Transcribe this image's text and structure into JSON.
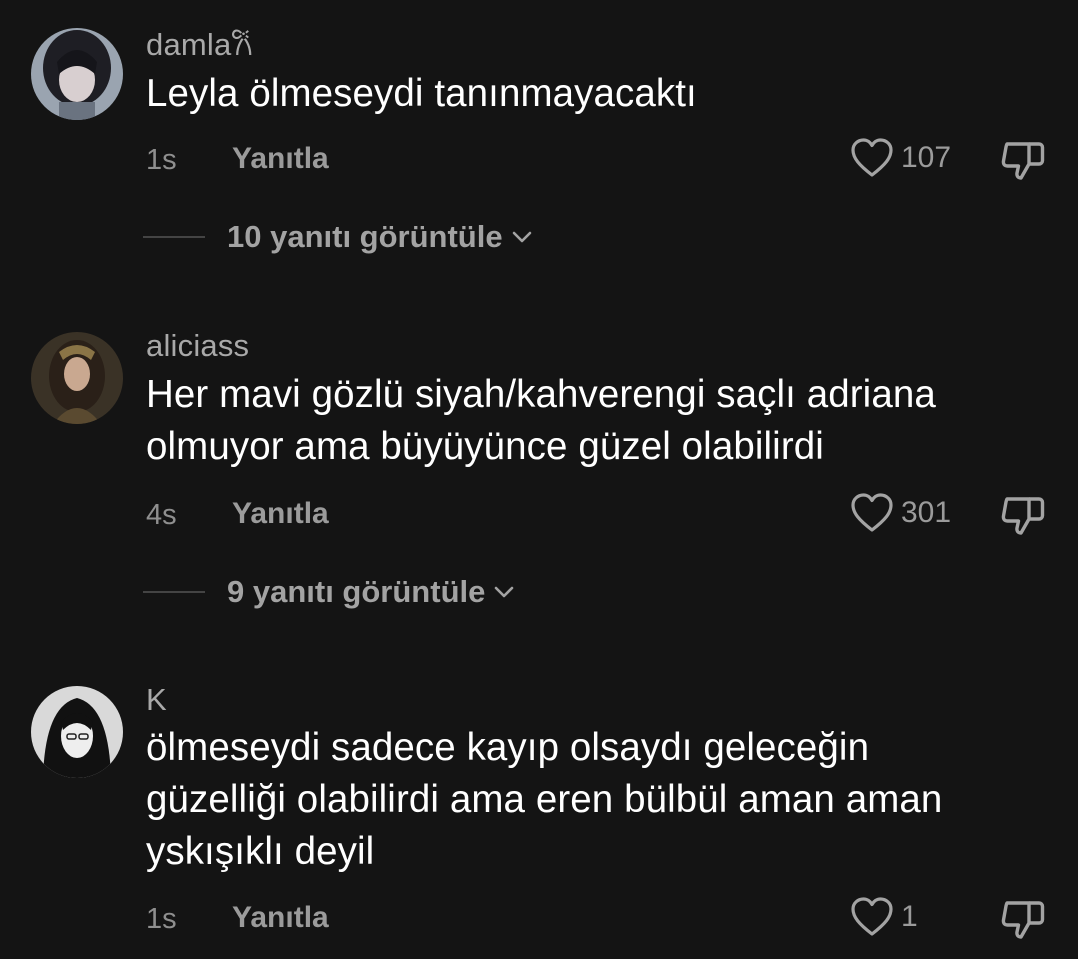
{
  "comments": [
    {
      "username": "damla𐙚",
      "text": "Leyla ölmeseydi tanınmayacaktı",
      "time": "1s",
      "reply_label": "Yanıtla",
      "likes": "107",
      "view_replies": "10 yanıtı görüntüle"
    },
    {
      "username": "aliciass",
      "text": "Her mavi gözlü siyah/kahverengi saçlı adriana olmuyor ama büyüyünce güzel olabilirdi",
      "time": "4s",
      "reply_label": "Yanıtla",
      "likes": "301",
      "view_replies": "9 yanıtı görüntüle"
    },
    {
      "username": "K",
      "text": "ölmeseydi sadece kayıp olsaydı geleceğin güzelliği olabilirdi ama eren bülbül aman aman yskışıklı deyil",
      "time": "1s",
      "reply_label": "Yanıtla",
      "likes": "1"
    }
  ],
  "icons": {
    "like": "heart-outline-icon",
    "dislike": "thumbs-down-outline-icon",
    "expand": "chevron-down-icon"
  },
  "colors": {
    "background": "#141414",
    "text_primary": "#ffffff",
    "text_secondary": "#9b9b9b"
  }
}
